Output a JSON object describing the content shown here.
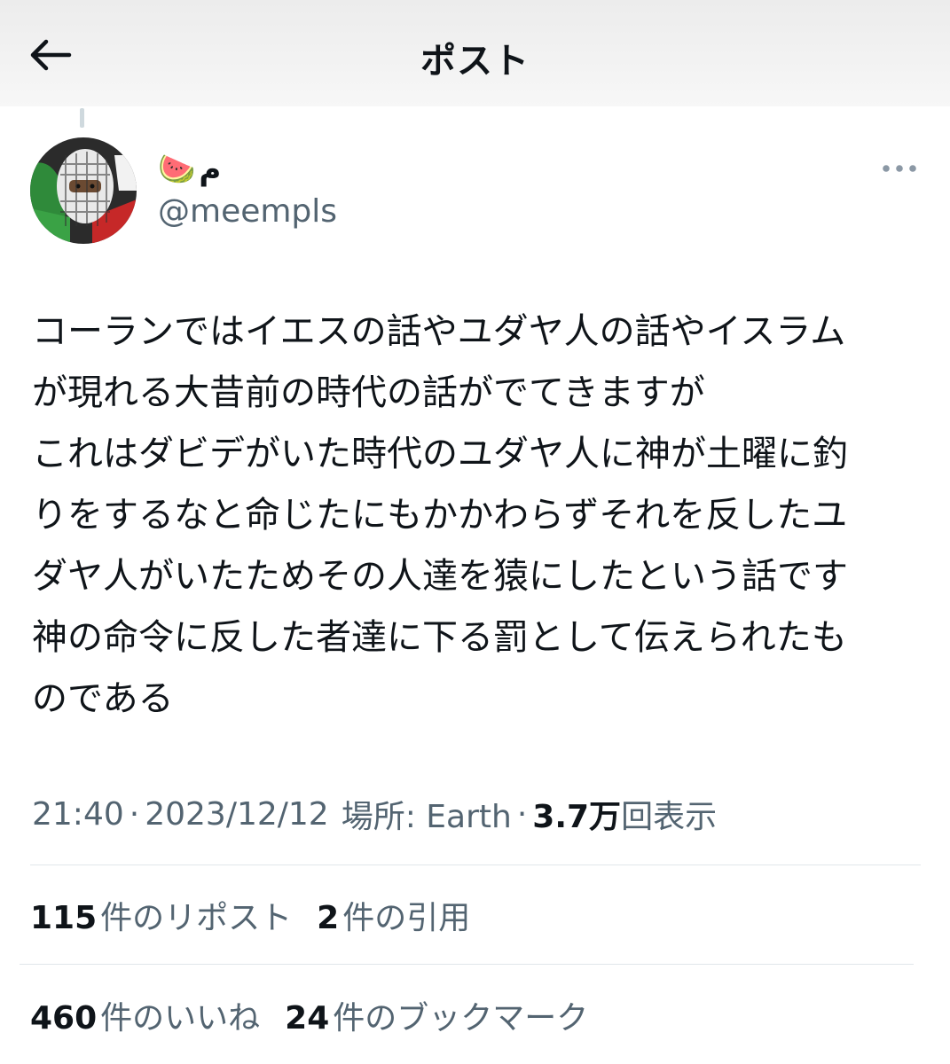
{
  "header": {
    "title": "ポスト"
  },
  "author": {
    "display_name": "م",
    "display_emoji": "🍉",
    "handle": "@meempls"
  },
  "post": {
    "lines": [
      "コーランではイエスの話やユダヤ人の話やイスラム",
      "が現れる大昔前の時代の話がでてきますが",
      "これはダビデがいた時代のユダヤ人に神が土曜に釣",
      "りをするなと命じたにもかかわらずそれを反したユ",
      "ダヤ人がいたためその人達を猿にしたという話です",
      "神の命令に反した者達に下る罰として伝えられたも",
      "のである"
    ]
  },
  "meta": {
    "time": "21:40",
    "date": "2023/12/12",
    "location_label": "場所: Earth",
    "views_count": "3.7万",
    "views_label": "回表示"
  },
  "stats": {
    "reposts_count": "115",
    "reposts_label": "件のリポスト",
    "quotes_count": "2",
    "quotes_label": "件の引用",
    "likes_count": "460",
    "likes_label": "件のいいね",
    "bookmarks_count": "24",
    "bookmarks_label": "件のブックマーク"
  },
  "colors": {
    "text_primary": "#0f1419",
    "text_secondary": "#536471",
    "divider": "#e1e6ea"
  }
}
